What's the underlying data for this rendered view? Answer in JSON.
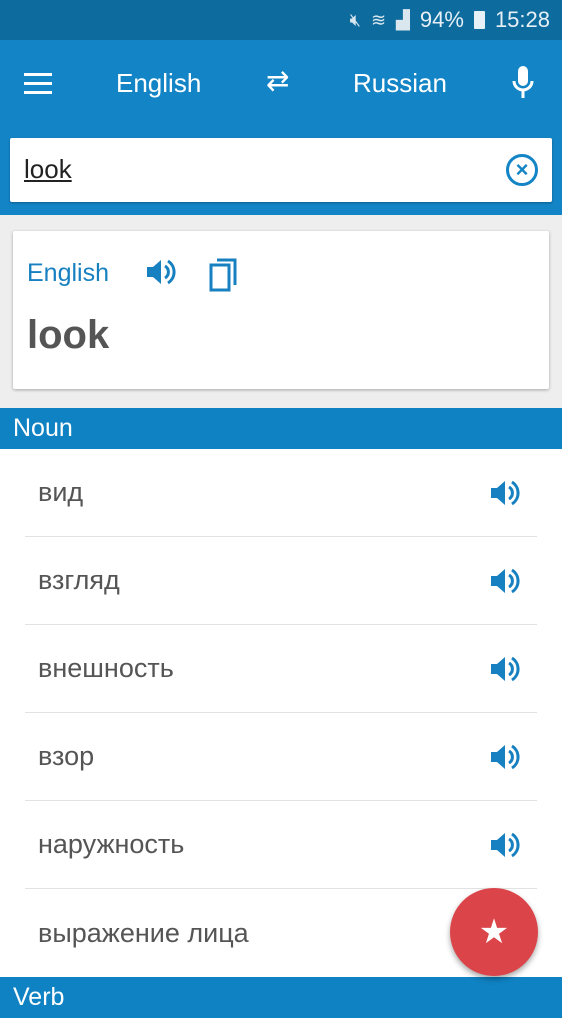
{
  "status": {
    "battery": "94%",
    "time": "15:28"
  },
  "appbar": {
    "source_lang": "English",
    "target_lang": "Russian"
  },
  "search": {
    "value": "look"
  },
  "card": {
    "lang": "English",
    "word": "look"
  },
  "sections": [
    {
      "label": "Noun",
      "items": [
        "вид",
        "взгляд",
        "внешность",
        "взор",
        "наружность",
        "выражение лица"
      ]
    },
    {
      "label": "Verb"
    }
  ],
  "colors": {
    "primary": "#1384c5",
    "status": "#0d6b9d",
    "fab": "#db4549"
  }
}
